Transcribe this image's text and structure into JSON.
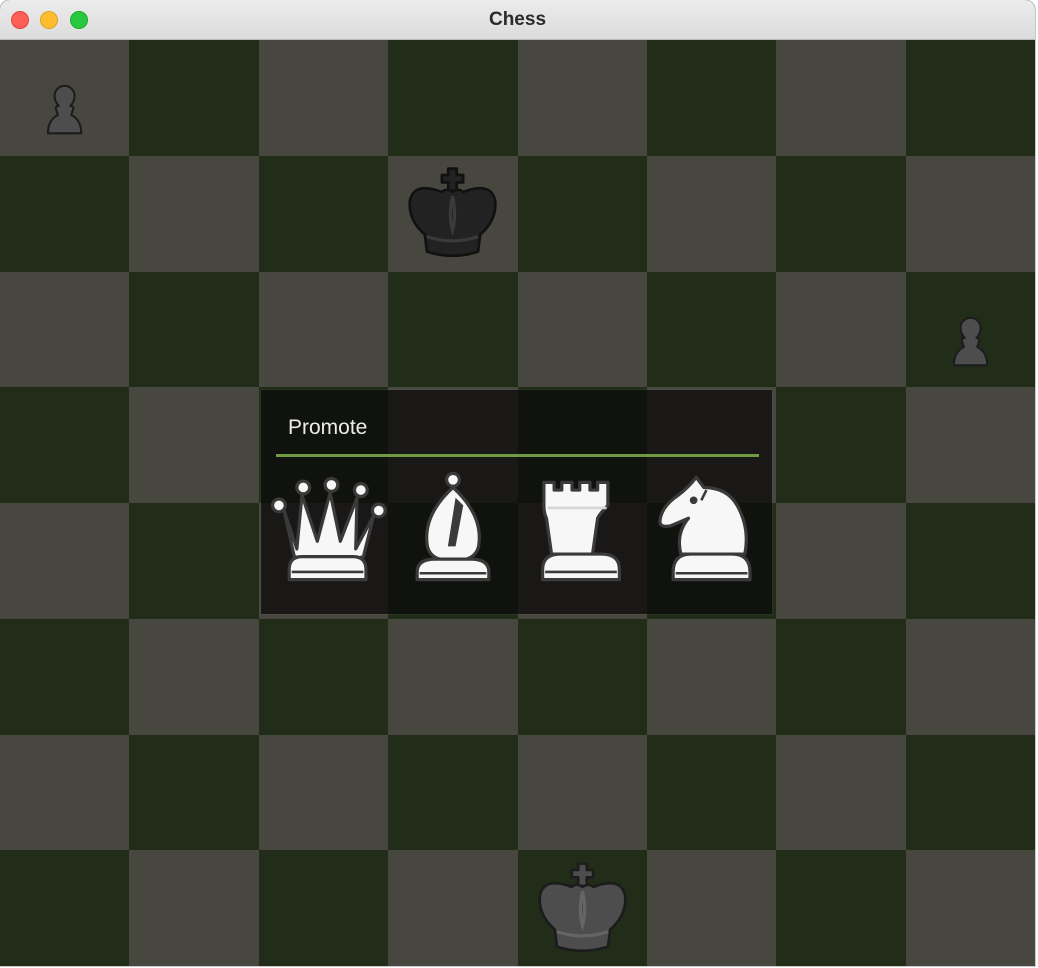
{
  "window": {
    "title": "Chess"
  },
  "board": {
    "colors": {
      "light": "#48473f",
      "dark": "#212d18"
    },
    "files": [
      "a",
      "b",
      "c",
      "d",
      "e",
      "f",
      "g",
      "h"
    ],
    "ranks": [
      "8",
      "7",
      "6",
      "5",
      "4",
      "3",
      "2",
      "1"
    ],
    "pieces": [
      {
        "square": "a8",
        "type": "pawn",
        "color": "black"
      },
      {
        "square": "d7",
        "type": "king",
        "color": "black"
      },
      {
        "square": "h6",
        "type": "pawn",
        "color": "black"
      },
      {
        "square": "e1",
        "type": "king",
        "color": "black"
      }
    ]
  },
  "promotion": {
    "title": "Promote",
    "accent": "#6f9a41",
    "options": [
      {
        "piece": "queen",
        "color": "white"
      },
      {
        "piece": "bishop",
        "color": "white"
      },
      {
        "piece": "rook",
        "color": "white"
      },
      {
        "piece": "knight",
        "color": "white"
      }
    ]
  }
}
